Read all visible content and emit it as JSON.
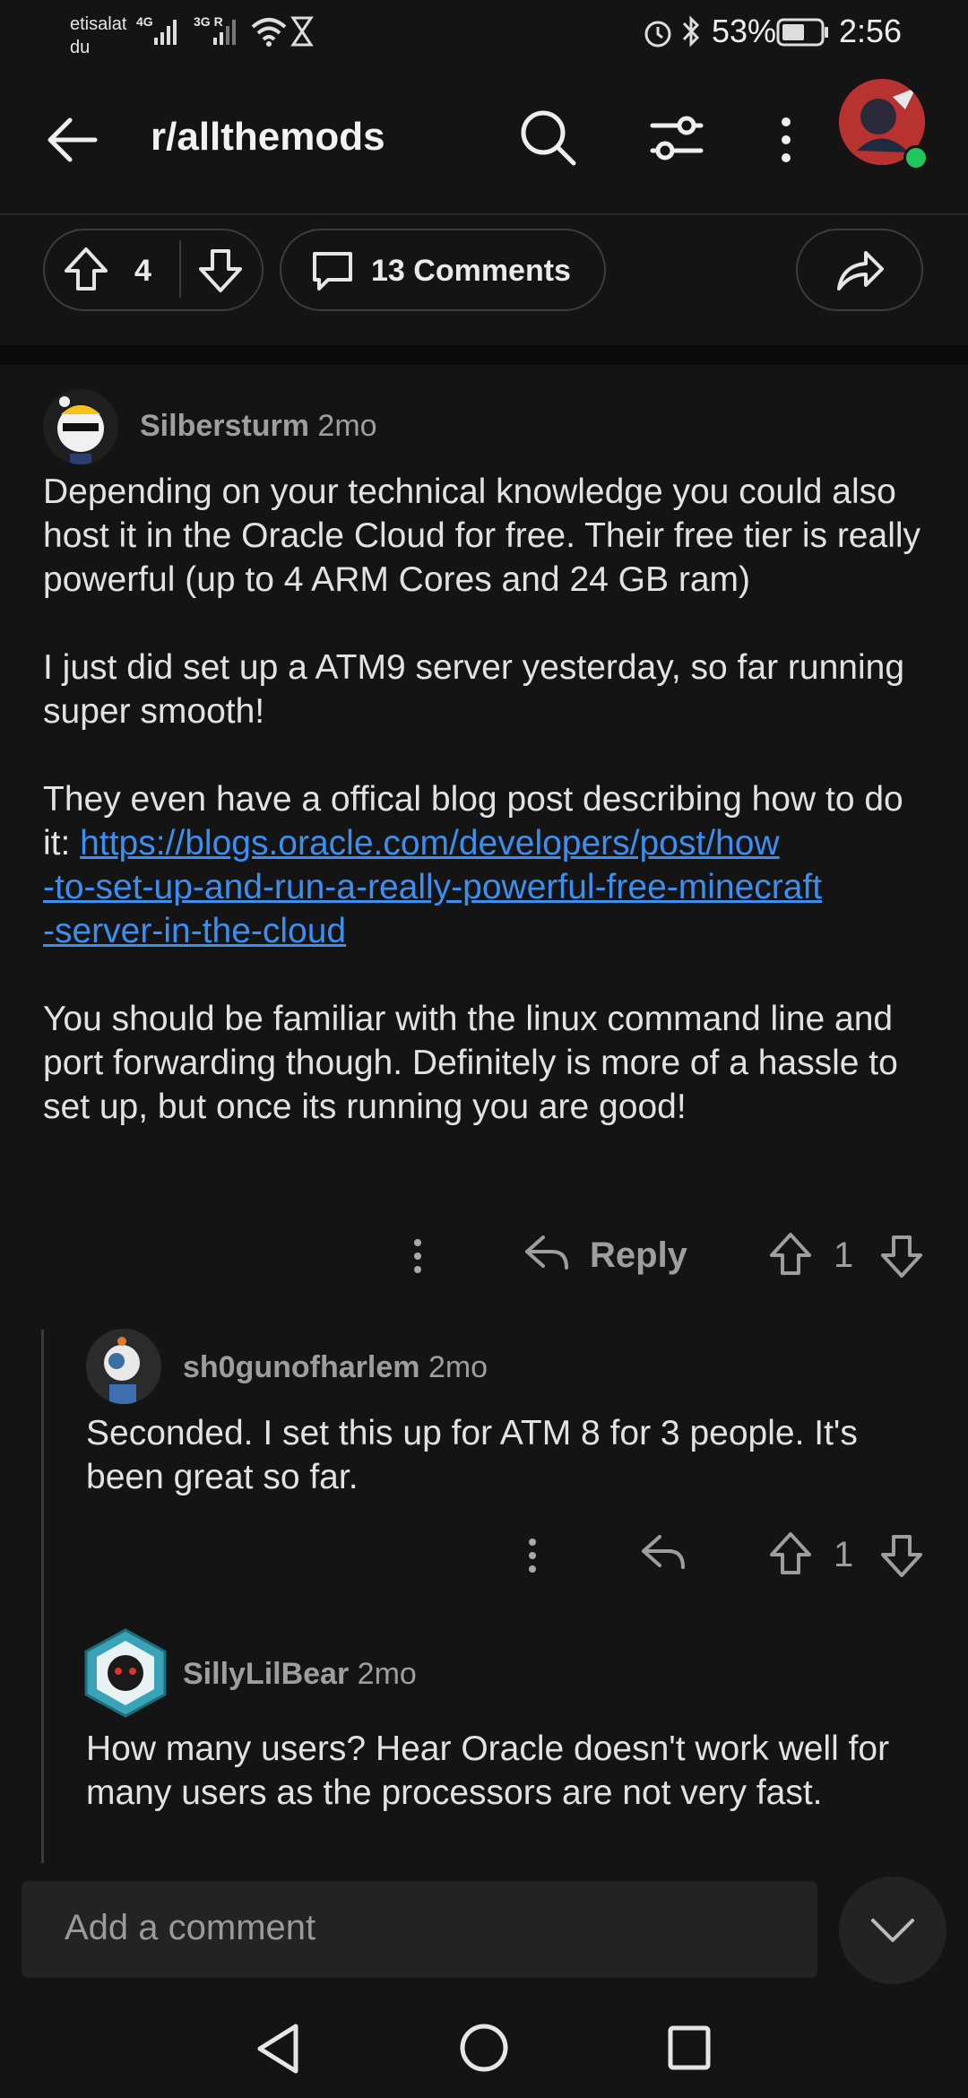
{
  "status_bar": {
    "carrier_line1": "etisalat",
    "carrier_line2": "du",
    "net1": "4G",
    "net2": "3G R",
    "battery": "53%",
    "time": "2:56"
  },
  "header": {
    "title": "r/allthemods"
  },
  "actions": {
    "vote_count": "4",
    "comments_label": "13 Comments"
  },
  "comments": [
    {
      "author": "Silbersturm",
      "age": "2mo",
      "paragraphs": [
        "Depending on your technical knowledge you could also host it in the Oracle Cloud for free. Their free tier is really powerful (up to 4 ARM Cores and 24 GB ram)",
        "I just did set up a ATM9 server yesterday, so far running super smooth!",
        "They even have a offical blog post describing how to do it: ",
        "You should be familiar with the linux command line and port forwarding though. Definitely is more of a hassle to set up, but once its running you are good!"
      ],
      "link_line1": "https://blogs.oracle.com/developers/post/how",
      "link_line2": "-to-set-up-and-run-a-really-powerful-free-minecraft",
      "link_line3": "-server-in-the-cloud",
      "reply_label": "Reply",
      "votes": "1"
    },
    {
      "author": "sh0gunofharlem",
      "age": "2mo",
      "text": "Seconded.  I set this up for ATM 8 for 3 people. It's been great so far.",
      "votes": "1"
    },
    {
      "author": "SillyLilBear",
      "age": "2mo",
      "text": "How many users?  Hear Oracle doesn't work well for many users as the processors are not very fast."
    }
  ],
  "composer": {
    "placeholder": "Add a comment"
  },
  "colors": {
    "background": "#141414",
    "link": "#3b8ff0",
    "online_dot": "#22c55e"
  }
}
